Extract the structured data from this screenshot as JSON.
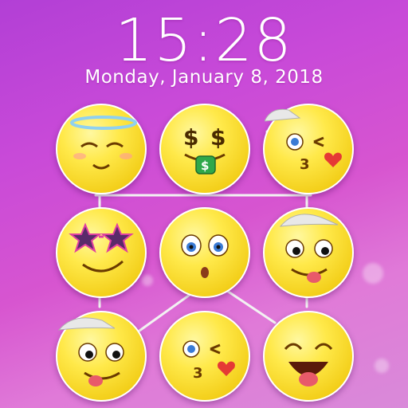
{
  "lockscreen": {
    "time": "15:28",
    "date": "Monday, January 8, 2018"
  },
  "pattern": {
    "nodes": [
      {
        "id": "n1",
        "face": "sleepy-face"
      },
      {
        "id": "n2",
        "face": "money-mouth-face"
      },
      {
        "id": "n3",
        "face": "kissing-wink-face"
      },
      {
        "id": "n4",
        "face": "star-glasses-face"
      },
      {
        "id": "n5",
        "face": "surprised-face"
      },
      {
        "id": "n6",
        "face": "tongue-face-cap"
      },
      {
        "id": "n7",
        "face": "tongue-face-cap"
      },
      {
        "id": "n8",
        "face": "kissing-wink-face"
      },
      {
        "id": "n9",
        "face": "laughing-tongue-face"
      }
    ],
    "line_color": "#f2f2f2"
  }
}
